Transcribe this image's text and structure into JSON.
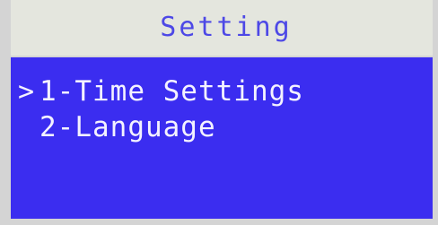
{
  "screen": {
    "title": "Setting",
    "cursor_glyph": ">",
    "selected_index": 0,
    "items": [
      {
        "label": "1-Time Settings"
      },
      {
        "label": "2-Language"
      }
    ],
    "colors": {
      "header_bg": "#e4e6de",
      "header_text": "#4d48e6",
      "screen_bg": "#3b2df0",
      "text": "#f4f2ff"
    }
  }
}
